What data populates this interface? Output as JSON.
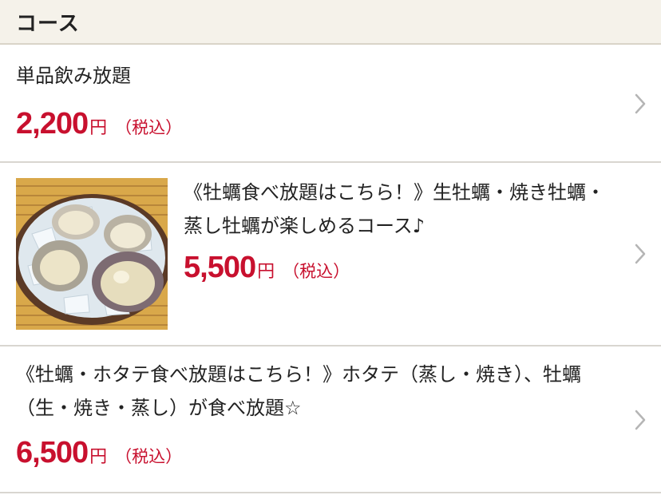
{
  "header": {
    "title": "コース"
  },
  "courses": [
    {
      "title": "単品飲み放題",
      "price": "2,200",
      "yen": "円",
      "tax": "（税込）",
      "icon": "chevron-right-icon"
    },
    {
      "title": "《牡蠣食べ放題はこちら！》生牡蠣・焼き牡蠣・蒸し牡蠣が楽しめるコース♪",
      "price": "5,500",
      "yen": "円",
      "tax": "（税込）",
      "image": "oysters-on-ice-photo",
      "icon": "chevron-right-icon"
    },
    {
      "title": "《牡蠣・ホタテ食べ放題はこちら！》ホタテ（蒸し・焼き）、牡蠣（生・焼き・蒸し）が食べ放題☆",
      "price": "6,500",
      "yen": "円",
      "tax": "（税込）",
      "icon": "chevron-right-icon"
    }
  ],
  "colors": {
    "price": "#c8102e",
    "header_bg": "#f5f2ea",
    "divider": "#d9d6d0",
    "chevron": "#b5b5b5"
  }
}
